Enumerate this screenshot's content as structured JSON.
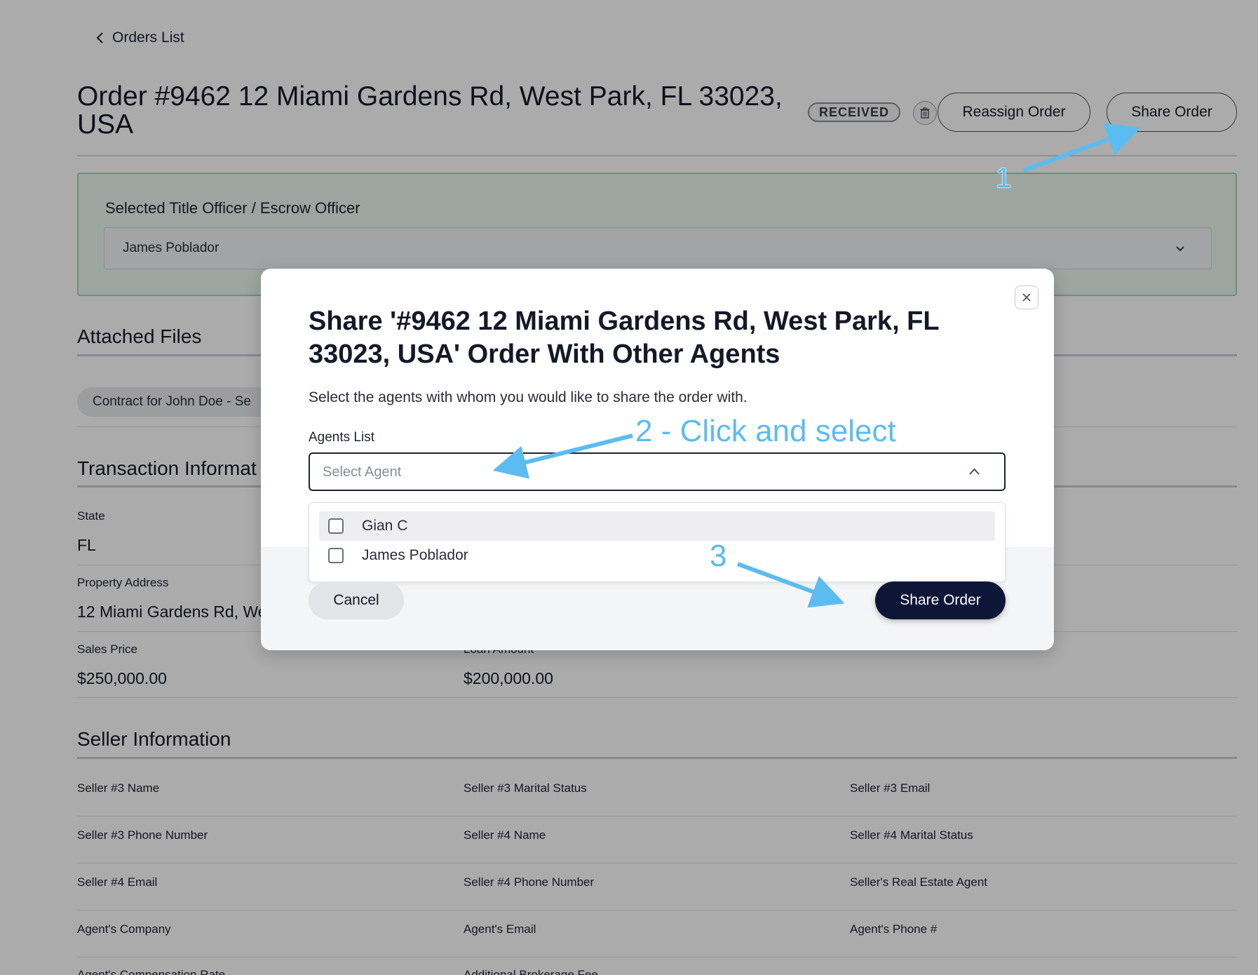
{
  "nav": {
    "back_label": "Orders List"
  },
  "header": {
    "title": "Order #9462 12 Miami Gardens Rd, West Park, FL 33023, USA",
    "status": "RECEIVED",
    "reassign_label": "Reassign Order",
    "share_label": "Share Order"
  },
  "officer": {
    "label": "Selected Title Officer / Escrow Officer",
    "selected": "James Poblador"
  },
  "attached_files": {
    "heading": "Attached Files",
    "files": [
      "Contract for John Doe - Se"
    ]
  },
  "transaction": {
    "heading": "Transaction Informat",
    "fields": [
      {
        "label": "State",
        "value": "FL"
      },
      {
        "label": "Property Address",
        "value": "12 Miami Gardens Rd, We"
      },
      {
        "label": "Sales Price",
        "value": "$250,000.00"
      },
      {
        "label": "Loan Amount",
        "value": "$200,000.00"
      }
    ]
  },
  "seller": {
    "heading": "Seller Information",
    "labels": [
      "Seller #3 Name",
      "Seller #3 Marital Status",
      "Seller #3 Email",
      "Seller #3 Phone Number",
      "Seller #4 Name",
      "Seller #4 Marital Status",
      "Seller #4 Email",
      "Seller #4 Phone Number",
      "Seller's Real Estate Agent",
      "Agent's Company",
      "Agent's Email",
      "Agent's Phone #",
      "Agent's Compensation Rate",
      "Additional Brokerage Fee"
    ]
  },
  "modal": {
    "title": "Share '#9462 12 Miami Gardens Rd, West Park, FL 33023, USA' Order With Other Agents",
    "description": "Select the agents with whom you would like to share the order with.",
    "agents_label": "Agents List",
    "select_placeholder": "Select Agent",
    "options": [
      "Gian C",
      "James Poblador"
    ],
    "cancel_label": "Cancel",
    "share_label": "Share Order"
  },
  "annotations": {
    "step1": "1",
    "step2": "2 - Click and select",
    "step3": "3",
    "color": "#5bbcf2"
  },
  "colors": {
    "primary_button": "#0e1638",
    "officer_box": "#e9f6ee",
    "officer_border": "#9fd6b7"
  }
}
